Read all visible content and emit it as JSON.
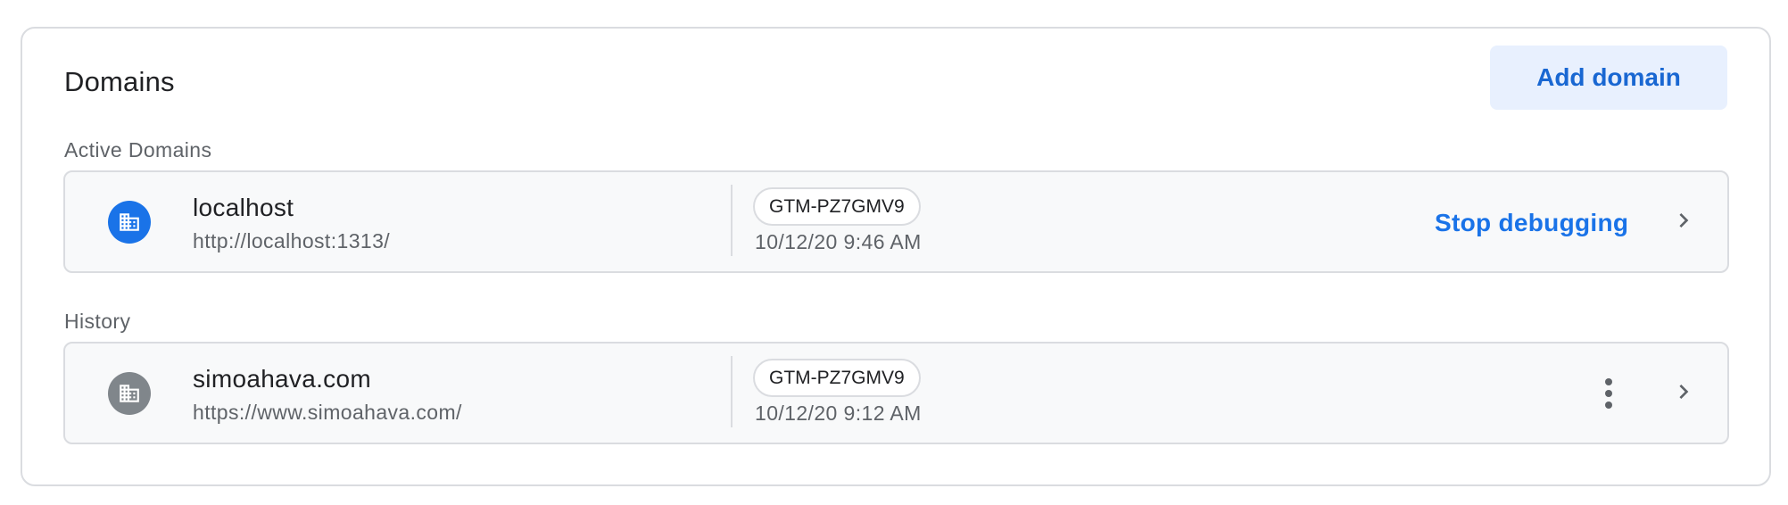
{
  "card": {
    "title": "Domains",
    "add_button_label": "Add domain"
  },
  "sections": {
    "active_label": "Active Domains",
    "history_label": "History"
  },
  "active_domain": {
    "name": "localhost",
    "url": "http://localhost:1313/",
    "container_id": "GTM-PZ7GMV9",
    "timestamp": "10/12/20 9:46 AM",
    "action_label": "Stop debugging",
    "icon": "building-icon",
    "icon_color": "#1a73e8"
  },
  "history_domain": {
    "name": "simoahava.com",
    "url": "https://www.simoahava.com/",
    "container_id": "GTM-PZ7GMV9",
    "timestamp": "10/12/20 9:12 AM",
    "icon": "building-icon",
    "icon_color": "#80868b"
  },
  "colors": {
    "accent": "#1a73e8",
    "button_bg": "#e8f0fe",
    "row_bg": "#f8f9fa",
    "border": "#dadce0"
  }
}
